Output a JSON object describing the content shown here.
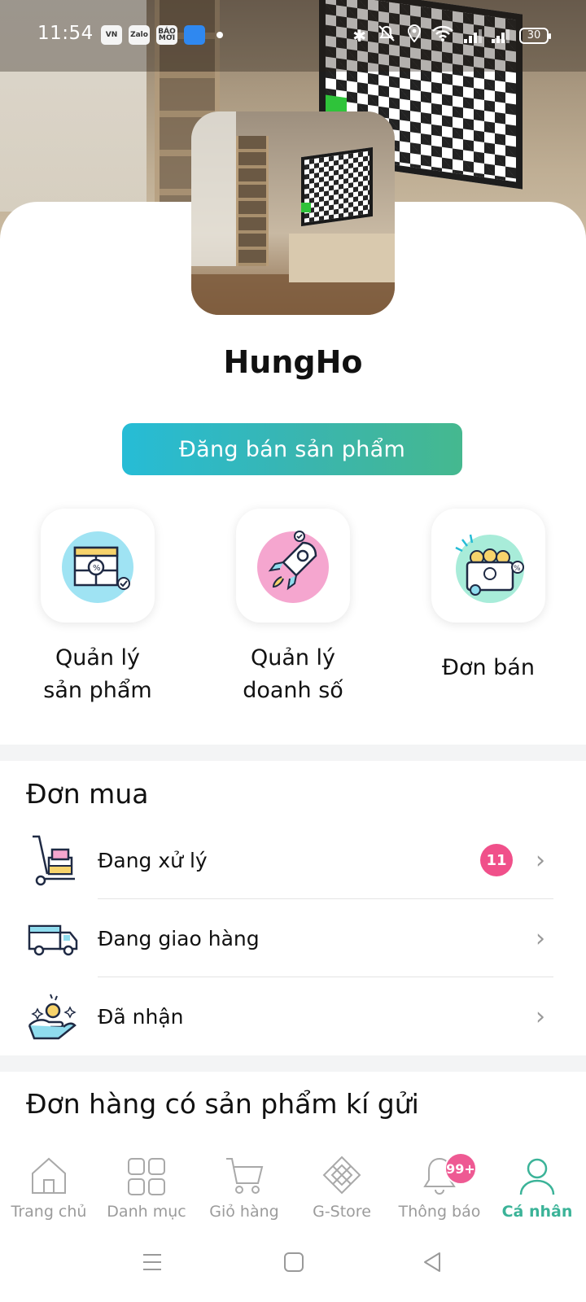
{
  "status_bar": {
    "time": "11:54",
    "notification_apps": [
      "VN",
      "Zalo",
      "BÁO MỚI",
      ""
    ],
    "battery": "30"
  },
  "profile": {
    "username": "HungHo",
    "cta_label": "Đăng bán sản phẩm"
  },
  "quick_actions": [
    {
      "label_line1": "Quản lý",
      "label_line2": "sản phẩm",
      "icon": "product-management-icon"
    },
    {
      "label_line1": "Quản lý",
      "label_line2": "doanh số",
      "icon": "sales-rocket-icon"
    },
    {
      "label_line1": "Đơn bán",
      "label_line2": "",
      "icon": "sales-orders-icon"
    }
  ],
  "purchase_orders": {
    "title": "Đơn mua",
    "items": [
      {
        "label": "Đang xử lý",
        "badge": "11",
        "icon": "hand-truck-icon"
      },
      {
        "label": "Đang giao hàng",
        "badge": "",
        "icon": "delivery-truck-icon"
      },
      {
        "label": "Đã nhận",
        "badge": "",
        "icon": "hand-coin-icon"
      }
    ]
  },
  "consignment": {
    "title": "Đơn hàng có sản phẩm kí gửi"
  },
  "bottom_nav": {
    "items": [
      {
        "label": "Trang chủ",
        "icon": "home-icon",
        "active": false
      },
      {
        "label": "Danh mục",
        "icon": "grid-icon",
        "active": false
      },
      {
        "label": "Giỏ hàng",
        "icon": "cart-icon",
        "active": false
      },
      {
        "label": "G-Store",
        "icon": "gstore-icon",
        "active": false
      },
      {
        "label": "Thông báo",
        "icon": "bell-icon",
        "active": false,
        "badge": "99+"
      },
      {
        "label": "Cá nhân",
        "icon": "user-icon",
        "active": true
      }
    ]
  },
  "colors": {
    "accent": "#3bb398",
    "cta_gradient_start": "#26bcd6",
    "cta_gradient_end": "#45b88f",
    "badge": "#f0508a"
  }
}
